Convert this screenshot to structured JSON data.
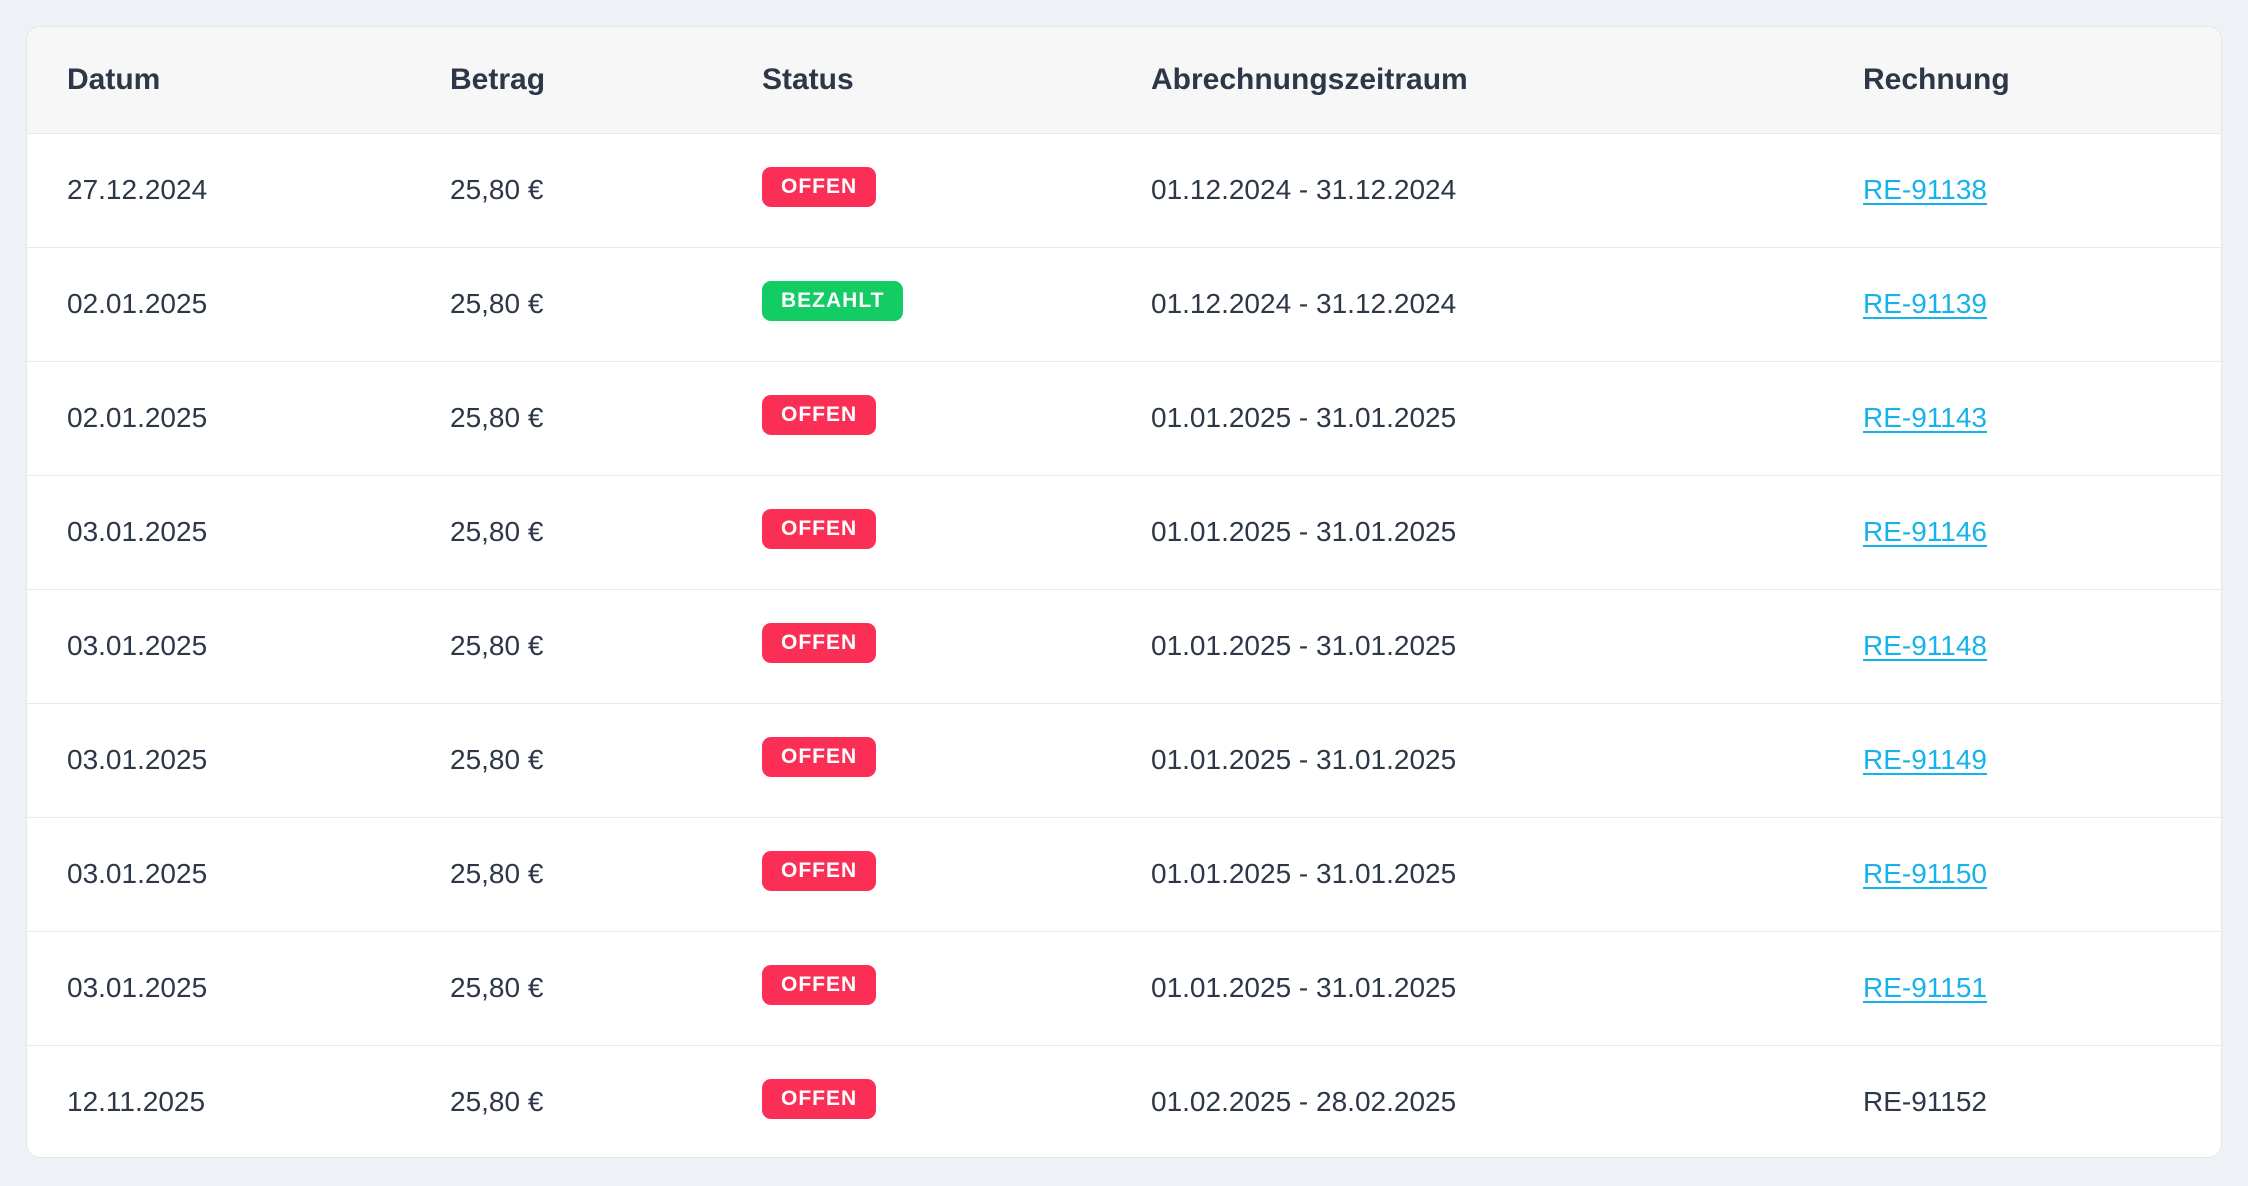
{
  "table": {
    "headers": {
      "date": "Datum",
      "amount": "Betrag",
      "status": "Status",
      "period": "Abrechnungszeitraum",
      "invoice": "Rechnung"
    },
    "status_colors": {
      "open": "#fb2f55",
      "paid": "#13cc63",
      "link": "#16b2ea"
    },
    "rows": [
      {
        "date": "27.12.2024",
        "amount": "25,80 €",
        "status": "OFFEN",
        "status_type": "open",
        "period": "01.12.2024 - 31.12.2024",
        "invoice": "RE-91138",
        "invoice_link": true
      },
      {
        "date": "02.01.2025",
        "amount": "25,80 €",
        "status": "BEZAHLT",
        "status_type": "paid",
        "period": "01.12.2024 - 31.12.2024",
        "invoice": "RE-91139",
        "invoice_link": true
      },
      {
        "date": "02.01.2025",
        "amount": "25,80 €",
        "status": "OFFEN",
        "status_type": "open",
        "period": "01.01.2025 - 31.01.2025",
        "invoice": "RE-91143",
        "invoice_link": true
      },
      {
        "date": "03.01.2025",
        "amount": "25,80 €",
        "status": "OFFEN",
        "status_type": "open",
        "period": "01.01.2025 - 31.01.2025",
        "invoice": "RE-91146",
        "invoice_link": true
      },
      {
        "date": "03.01.2025",
        "amount": "25,80 €",
        "status": "OFFEN",
        "status_type": "open",
        "period": "01.01.2025 - 31.01.2025",
        "invoice": "RE-91148",
        "invoice_link": true
      },
      {
        "date": "03.01.2025",
        "amount": "25,80 €",
        "status": "OFFEN",
        "status_type": "open",
        "period": "01.01.2025 - 31.01.2025",
        "invoice": "RE-91149",
        "invoice_link": true
      },
      {
        "date": "03.01.2025",
        "amount": "25,80 €",
        "status": "OFFEN",
        "status_type": "open",
        "period": "01.01.2025 - 31.01.2025",
        "invoice": "RE-91150",
        "invoice_link": true
      },
      {
        "date": "03.01.2025",
        "amount": "25,80 €",
        "status": "OFFEN",
        "status_type": "open",
        "period": "01.01.2025 - 31.01.2025",
        "invoice": "RE-91151",
        "invoice_link": true
      },
      {
        "date": "12.11.2025",
        "amount": "25,80 €",
        "status": "OFFEN",
        "status_type": "open",
        "period": "01.02.2025 - 28.02.2025",
        "invoice": "RE-91152",
        "invoice_link": false
      }
    ]
  }
}
